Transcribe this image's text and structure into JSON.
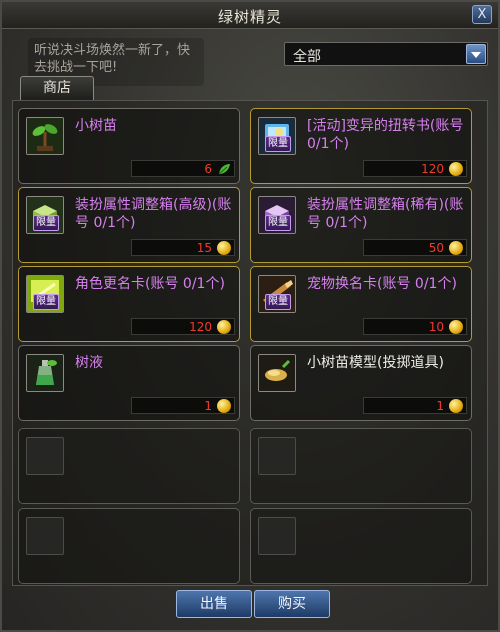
{
  "window": {
    "title": "绿树精灵",
    "close_label": "X"
  },
  "npc_speech": "听说决斗场焕然一新了，快去挑战一下吧!",
  "filter": {
    "selected": "全部"
  },
  "tab": {
    "label": "商店"
  },
  "colors": {
    "name_purple": "#d680ee",
    "price_red": "#ef3b2d",
    "limited_border": "#b49a34",
    "button_blue": "#4e76ad"
  },
  "items": [
    {
      "name": "小树苗",
      "price": "6",
      "currency_icon": "leaf-currency-icon",
      "limited": false,
      "name_color": "purple",
      "icon": "sapling-icon"
    },
    {
      "name": "[活动]变异的扭转书(账号 0/1个)",
      "price": "120",
      "currency_icon": "gold-coin-icon",
      "limited": true,
      "limit_badge": "限量",
      "name_color": "purple",
      "icon": "book-icon"
    },
    {
      "name": "装扮属性调整箱(高级)(账号 0/1个)",
      "price": "15",
      "currency_icon": "gold-coin-icon",
      "limited": true,
      "limit_badge": "限量",
      "name_color": "purple",
      "icon": "green-box-icon"
    },
    {
      "name": "装扮属性调整箱(稀有)(账号 0/1个)",
      "price": "50",
      "currency_icon": "gold-coin-icon",
      "limited": true,
      "limit_badge": "限量",
      "name_color": "purple",
      "icon": "purple-box-icon"
    },
    {
      "name": "角色更名卡(账号 0/1个)",
      "price": "120",
      "currency_icon": "gold-coin-icon",
      "limited": true,
      "limit_badge": "限量",
      "name_color": "purple",
      "icon": "rename-card-icon"
    },
    {
      "name": "宠物换名卡(账号 0/1个)",
      "price": "10",
      "currency_icon": "gold-coin-icon",
      "limited": true,
      "limit_badge": "限量",
      "name_color": "purple",
      "icon": "pet-card-icon"
    },
    {
      "name": "树液",
      "price": "1",
      "currency_icon": "gold-coin-icon",
      "limited": false,
      "name_color": "purple",
      "icon": "sap-bottle-icon"
    },
    {
      "name": "小树苗模型(投掷道具)",
      "price": "1",
      "currency_icon": "gold-coin-icon",
      "limited": false,
      "name_color": "white",
      "icon": "sapling-model-icon"
    }
  ],
  "buttons": {
    "sell": "出售",
    "buy": "购买"
  }
}
